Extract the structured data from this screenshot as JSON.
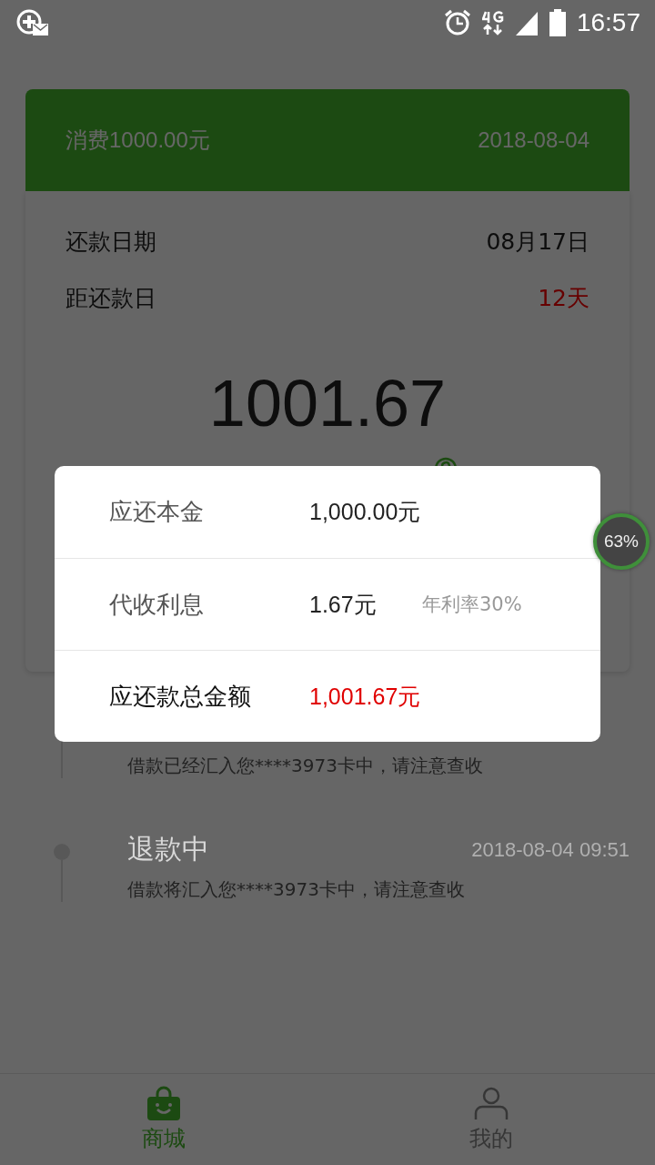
{
  "status_bar": {
    "time": "16:57"
  },
  "order": {
    "title": "消费1000.00元",
    "date": "2018-08-04"
  },
  "repayment": {
    "rows": [
      {
        "label": "还款日期",
        "value": "08月17日",
        "highlight": false
      },
      {
        "label": "距还款日",
        "value": "12天",
        "highlight": true
      }
    ],
    "amount": "1001.67"
  },
  "timeline": [
    {
      "description": "借款已经汇入您****3973卡中，请注意查收"
    },
    {
      "title": "退款中",
      "time": "2018-08-04 09:51",
      "description": "借款将汇入您****3973卡中，请注意查收"
    }
  ],
  "dialog": {
    "rows": [
      {
        "label": "应还本金",
        "value": "1,000.00元",
        "emphasis": false
      },
      {
        "label": "代收利息",
        "value": "1.67元",
        "note": "年利率30%",
        "emphasis": false
      },
      {
        "label": "应还款总金额",
        "value": "1,001.67元",
        "emphasis": true
      }
    ]
  },
  "floating_widget": {
    "text": "63%"
  },
  "tab_bar": [
    {
      "label": "商城",
      "selected": true
    },
    {
      "label": "我的",
      "selected": false
    }
  ]
}
